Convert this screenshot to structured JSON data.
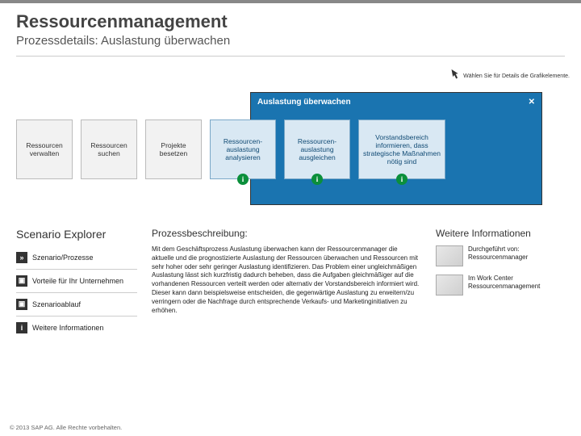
{
  "header": {
    "title": "Ressourcenmanagement",
    "subtitle": "Prozessdetails: Auslastung überwachen"
  },
  "hint": "Wählen Sie für Details die Grafikelemente.",
  "panel": {
    "title": "Auslastung überwachen",
    "close": "✕"
  },
  "chips": {
    "c1": "Ressourcen verwalten",
    "c2": "Ressourcen suchen",
    "c3": "Projekte besetzen",
    "c4": "Ressourcen-auslastung analysieren",
    "c5": "Ressourcen-auslastung ausgleichen",
    "c6": "Vorstandsbereich informieren, dass strategische Maßnahmen nötig sind"
  },
  "scenario_explorer": {
    "title": "Scenario Explorer",
    "items": {
      "a": {
        "icon": "»",
        "label": "Szenario/Prozesse"
      },
      "b": {
        "icon": "▣",
        "label": "Vorteile für Ihr Unternehmen"
      },
      "c": {
        "icon": "▣",
        "label": "Szenarioablauf"
      },
      "d": {
        "icon": "i",
        "label": "Weitere Informationen"
      }
    }
  },
  "process": {
    "heading": "Prozessbeschreibung:",
    "body": "Mit dem Geschäftsprozess Auslastung überwachen kann der Ressourcenmanager die aktuelle und die prognostizierte Auslastung der Ressourcen überwachen und Ressourcen mit sehr hoher oder sehr geringer Auslastung identifizieren. Das Problem einer ungleichmäßigen Auslastung lässt sich kurzfristig dadurch beheben, dass die Aufgaben gleichmäßiger auf die vorhandenen Ressourcen verteilt werden oder alternativ der Vorstandsbereich informiert wird. Dieser kann dann beispielsweise entscheiden, die gegenwärtige Auslastung zu erweitern/zu verringern oder die Nachfrage durch entsprechende Verkaufs- und Marketinginitiativen zu erhöhen."
  },
  "more_info": {
    "heading": "Weitere Informationen",
    "r1": "Durchgeführt von: Ressourcenmanager",
    "r2": "Im Work Center Ressourcenmanagement"
  },
  "footer": "© 2013 SAP AG. Alle Rechte vorbehalten."
}
